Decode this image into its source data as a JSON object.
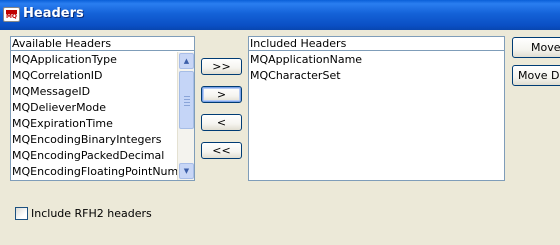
{
  "window": {
    "title": "Headers",
    "icon_text": "MQ",
    "icon": "mq-app-icon"
  },
  "available": {
    "header": "Available Headers",
    "items": [
      "MQApplicationType",
      "MQCorrelationID",
      "MQMessageID",
      "MQDelieverMode",
      "MQExpirationTime",
      "MQEncodingBinaryIntegers",
      "MQEncodingPackedDecimal",
      "MQEncodingFloatingPointNumbers"
    ]
  },
  "included": {
    "header": "Included Headers",
    "items": [
      "MQApplicationName",
      "MQCharacterSet"
    ]
  },
  "buttons": {
    "add_all": ">>",
    "add": ">",
    "remove": "<",
    "remove_all": "<<",
    "move_up": "Move",
    "move_down": "Move D"
  },
  "rfh2": {
    "label": "Include RFH2 headers",
    "checked": false
  },
  "colors": {
    "titlebar": "#0a5fd8",
    "dialog_bg": "#ece9d8",
    "list_border": "#7f9db9"
  }
}
